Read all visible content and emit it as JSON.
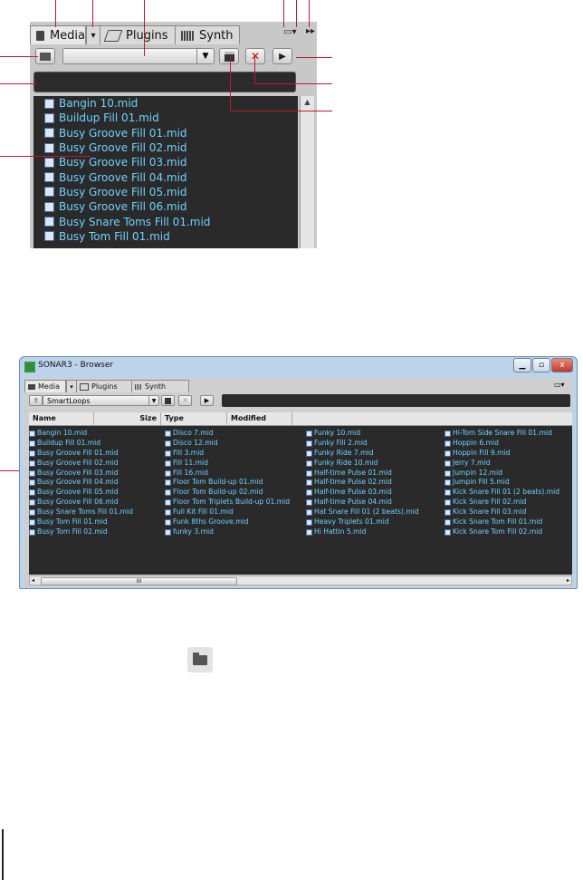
{
  "zoom": {
    "tabs": [
      {
        "label": "Media",
        "icon": "folder-icon"
      },
      {
        "label": "▾",
        "icon": "dropdown-arrow-icon"
      },
      {
        "label": "Plugins",
        "icon": "plugin-icon"
      },
      {
        "label": "Synth",
        "icon": "keyboard-icon"
      }
    ],
    "tab_right_icons": [
      "layout-icon",
      "dropdown-arrow-icon",
      "fast-forward-icon"
    ],
    "toolbar": {
      "up_icon": "up-folder-icon",
      "save_icon": "save-icon",
      "delete_label": "✕",
      "play_label": "▶"
    },
    "files": [
      "Bangin 10.mid",
      "Buildup Fill 01.mid",
      "Busy Groove Fill 01.mid",
      "Busy Groove Fill 02.mid",
      "Busy Groove Fill 03.mid",
      "Busy Groove Fill 04.mid",
      "Busy Groove Fill 05.mid",
      "Busy Groove Fill 06.mid",
      "Busy Snare Toms Fill 01.mid",
      "Busy Tom Fill 01.mid"
    ]
  },
  "window": {
    "title": "SONAR3 - Browser",
    "tabs": [
      "Media",
      "Plugins",
      "Synth"
    ],
    "combo_value": "SmartLoops",
    "columns": [
      "Name",
      "Size",
      "Type",
      "Modified"
    ],
    "file_columns": [
      [
        "Bangin 10.mid",
        "Buildup Fill 01.mid",
        "Busy Groove Fill 01.mid",
        "Busy Groove Fill 02.mid",
        "Busy Groove Fill 03.mid",
        "Busy Groove Fill 04.mid",
        "Busy Groove Fill 05.mid",
        "Busy Groove Fill 06.mid",
        "Busy Snare Toms Fill 01.mid",
        "Busy Tom Fill 01.mid",
        "Busy Tom Fill 02.mid"
      ],
      [
        "Disco 7.mid",
        "Disco 12.mid",
        "Fill 3.mid",
        "Fill 11.mid",
        "Fill 16.mid",
        "Floor Tom Build-up 01.mid",
        "Floor Tom Build-up 02.mid",
        "Floor Tom Triplets Build-up 01.mid",
        "Full Kit Fill 01.mid",
        "Funk 8ths Groove.mid",
        "funky 3.mid"
      ],
      [
        "Funky 10.mid",
        "Funky Fill 2.mid",
        "Funky Ride 7.mid",
        "Funky Ride 10.mid",
        "Half-time Pulse 01.mid",
        "Half-time Pulse 02.mid",
        "Half-time Pulse 03.mid",
        "Half-time Pulse 04.mid",
        "Hat Snare Fill 01 (2 beats).mid",
        "Heavy Triplets 01.mid",
        "Hi Hattin 5.mid"
      ],
      [
        "Hi-Tom Side Snare Fill 01.mid",
        "Hoppin 6.mid",
        "Hoppin Fill 9.mid",
        "Jerry 7.mid",
        "Jumpin 12.mid",
        "Jumpin Fill 5.mid",
        "Kick Snare Fill 01 (2 beats).mid",
        "Kick Snare Fill 02.mid",
        "Kick Snare Fill 03.mid",
        "Kick Snare Tom Fill 01.mid",
        "Kick Snare Tom Fill 02.mid"
      ]
    ],
    "scroll_thumb_label": "III"
  }
}
